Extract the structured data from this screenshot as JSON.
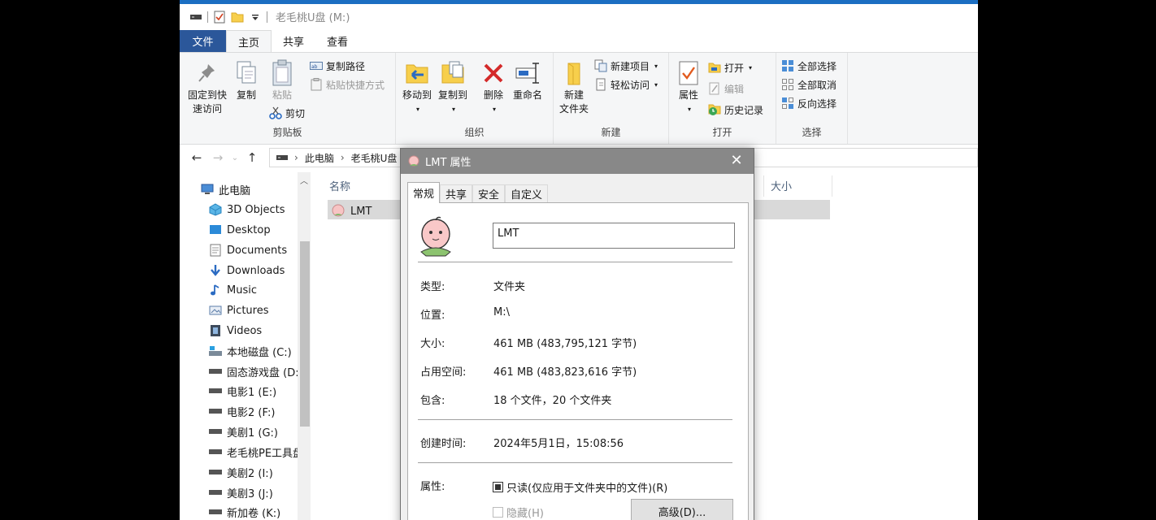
{
  "window": {
    "title": "老毛桃U盘 (M:)",
    "tabs": [
      "文件",
      "主页",
      "共享",
      "查看"
    ]
  },
  "ribbon": {
    "clipboard": {
      "label": "剪贴板",
      "pin": "固定到快\n速访问",
      "copy": "复制",
      "paste": "粘贴",
      "copy_path": "复制路径",
      "paste_shortcut": "粘贴快捷方式",
      "cut": "剪切"
    },
    "organize": {
      "label": "组织",
      "move_to": "移动到",
      "copy_to": "复制到",
      "delete": "删除",
      "rename": "重命名"
    },
    "new": {
      "label": "新建",
      "new_folder": "新建\n文件夹",
      "new_item": "新建项目",
      "easy_access": "轻松访问"
    },
    "open": {
      "label": "打开",
      "properties": "属性",
      "open": "打开",
      "edit": "编辑",
      "history": "历史记录"
    },
    "select": {
      "label": "选择",
      "select_all": "全部选择",
      "select_none": "全部取消",
      "invert": "反向选择"
    }
  },
  "address": {
    "crumbs": [
      "此电脑",
      "老毛桃U盘"
    ]
  },
  "sidebar": {
    "items": [
      {
        "label": "此电脑",
        "icon": "computer-icon"
      },
      {
        "label": "3D Objects",
        "icon": "cube-icon"
      },
      {
        "label": "Desktop",
        "icon": "desktop-icon"
      },
      {
        "label": "Documents",
        "icon": "documents-icon"
      },
      {
        "label": "Downloads",
        "icon": "download-icon"
      },
      {
        "label": "Music",
        "icon": "music-icon"
      },
      {
        "label": "Pictures",
        "icon": "pictures-icon"
      },
      {
        "label": "Videos",
        "icon": "videos-icon"
      },
      {
        "label": "本地磁盘 (C:)",
        "icon": "system-drive-icon"
      },
      {
        "label": "固态游戏盘 (D:)",
        "icon": "drive-icon"
      },
      {
        "label": "电影1 (E:)",
        "icon": "drive-icon"
      },
      {
        "label": "电影2 (F:)",
        "icon": "drive-icon"
      },
      {
        "label": "美剧1 (G:)",
        "icon": "drive-icon"
      },
      {
        "label": "老毛桃PE工具盘",
        "icon": "drive-icon"
      },
      {
        "label": "美剧2 (I:)",
        "icon": "drive-icon"
      },
      {
        "label": "美剧3 (J:)",
        "icon": "drive-icon"
      },
      {
        "label": "新加卷 (K:)",
        "icon": "drive-icon"
      }
    ]
  },
  "filelist": {
    "col_name": "名称",
    "col_size": "大小",
    "row_name": "LMT"
  },
  "dialog": {
    "title": "LMT 属性",
    "tabs": [
      "常规",
      "共享",
      "安全",
      "自定义"
    ],
    "name_value": "LMT",
    "type_label": "类型:",
    "type_value": "文件夹",
    "location_label": "位置:",
    "location_value": "M:\\",
    "size_label": "大小:",
    "size_value": "461 MB (483,795,121 字节)",
    "disk_label": "占用空间:",
    "disk_value": "461 MB (483,823,616 字节)",
    "contains_label": "包含:",
    "contains_value": "18 个文件，20 个文件夹",
    "created_label": "创建时间:",
    "created_value": "2024年5月1日，15:08:56",
    "attr_label": "属性:",
    "readonly_label": "只读(仅应用于文件夹中的文件)(R)",
    "hidden_label": "隐藏(H)",
    "advanced_label": "高级(D)..."
  }
}
